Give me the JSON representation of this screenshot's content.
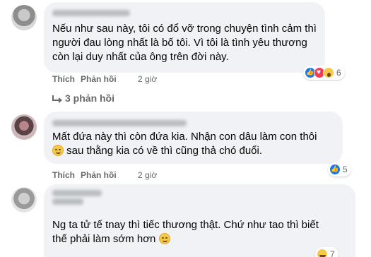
{
  "comments": [
    {
      "lines": [
        "Nếu như sau này, tôi có đổ vỡ trong chuyện tình cảm thì",
        "người đau lòng nhất là bố tôi. Vì tôi là tình yêu thương",
        "còn lại duy nhất của ông trên đời này."
      ],
      "like_label": "Thích",
      "reply_label": "Phản hồi",
      "time": "2 giờ",
      "reaction_icons": [
        "like-icon",
        "heart-icon",
        "wow-icon"
      ],
      "reaction_count": "6",
      "replies_label": "3 phản hồi"
    },
    {
      "lines": [
        "Mất đứa này thì còn đứa kia. Nhận con dâu làm con thôi",
        "sau thằng kia có về thì cũng thả chó đuổi."
      ],
      "like_label": "Thích",
      "reply_label": "Phản hồi",
      "time": "2 giờ",
      "reaction_icons": [
        "like-icon"
      ],
      "reaction_count": "5"
    },
    {
      "lines": [
        "Ng ta tử tế tnay thì tiếc thương thật. Chứ như tao thì biết",
        "thế phải làm sớm hơn"
      ],
      "reaction_icons": [
        "haha-icon"
      ],
      "reaction_count": "7"
    }
  ],
  "colors": {
    "bubble_bg": "#f0f2f5",
    "secondary_text": "#65676b",
    "like_blue": "#1877f2",
    "heart_red": "#f33e58"
  }
}
